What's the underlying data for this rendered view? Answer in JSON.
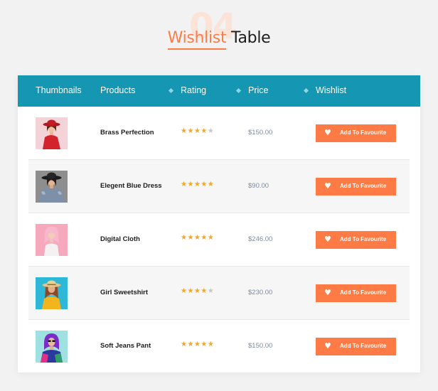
{
  "heading": {
    "number": "04",
    "accent_word": "Wishlist",
    "rest_word": " Table"
  },
  "table": {
    "columns": [
      "Thumbnails",
      "Products",
      "Rating",
      "Price",
      "Wishlist"
    ],
    "rows": [
      {
        "product": "Brass Perfection",
        "rating": 4,
        "price": "$150.00",
        "button": "Add To Favourite",
        "thumb": "woman-red-hat-red-coat"
      },
      {
        "product": "Elegent Blue Dress",
        "rating": 5,
        "price": "$90.00",
        "button": "Add To Favourite",
        "thumb": "woman-black-hat-fur-coat"
      },
      {
        "product": "Digital Cloth",
        "rating": 5,
        "price": "$246.00",
        "button": "Add To Favourite",
        "thumb": "woman-pink-hair"
      },
      {
        "product": "Girl Sweetshirt",
        "rating": 4,
        "price": "$230.00",
        "button": "Add To Favourite",
        "thumb": "woman-straw-hat-yellow"
      },
      {
        "product": "Soft Jeans Pant",
        "rating": 5,
        "price": "$150.00",
        "button": "Add To Favourite",
        "thumb": "woman-purple-hood"
      }
    ]
  },
  "icons": {
    "star": "star-icon",
    "heart": "heart-icon"
  },
  "colors": {
    "accent": "#ff7b45",
    "header_bg": "#1596b2",
    "star_on": "#f5a623",
    "star_off": "#c8c8c8",
    "price": "#7a8aa0"
  }
}
